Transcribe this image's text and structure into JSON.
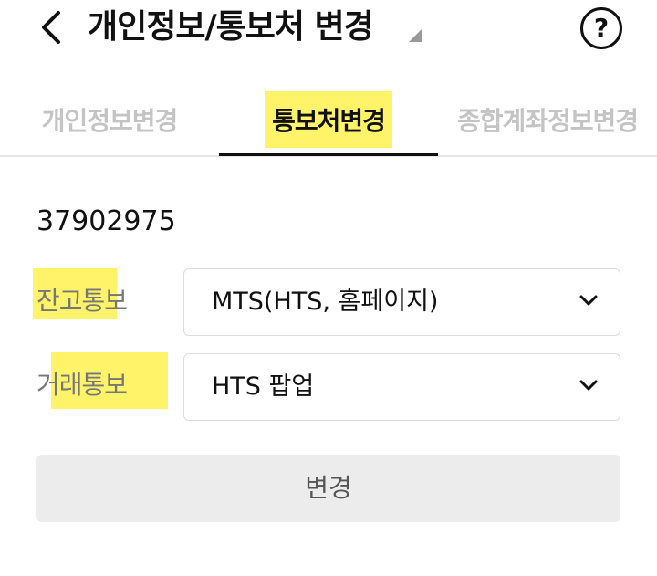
{
  "header": {
    "title": "개인정보/통보처 변경",
    "back_icon": "chevron-left-icon",
    "help_label": "?"
  },
  "tabs": [
    {
      "label": "개인정보변경",
      "active": false
    },
    {
      "label": "통보처변경",
      "active": true
    },
    {
      "label": "종합계좌정보변경",
      "active": false
    }
  ],
  "account_number": "37902975",
  "form": {
    "balance_notice": {
      "label": "잔고통보",
      "value": "MTS(HTS, 홈페이지)"
    },
    "trade_notice": {
      "label": "거래통보",
      "value": "HTS 팝업"
    }
  },
  "submit_label": "변경",
  "colors": {
    "highlight": "#fff36a",
    "active_tab": "#111111",
    "inactive_tab": "#c4c4c4",
    "button_bg": "#ececec"
  }
}
